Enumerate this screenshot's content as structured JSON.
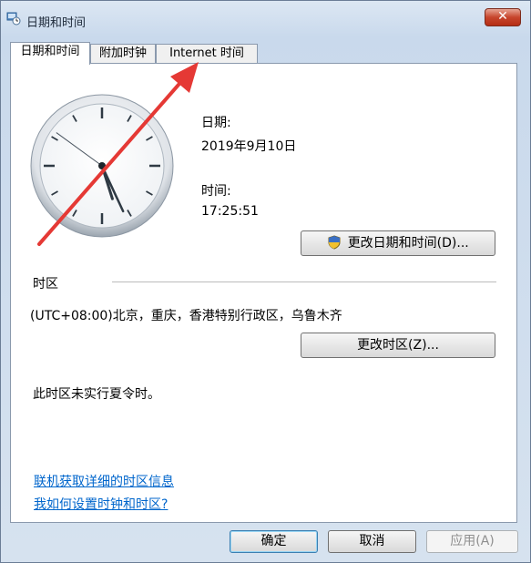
{
  "window": {
    "title": "日期和时间",
    "close_label": "✕"
  },
  "tabs": [
    {
      "label": "日期和时间",
      "active": true
    },
    {
      "label": "附加时钟",
      "active": false
    },
    {
      "label": "Internet 时间",
      "active": false
    }
  ],
  "datetime": {
    "date_label": "日期:",
    "date_value": "2019年9月10日",
    "time_label": "时间:",
    "time_value": "17:25:51",
    "change_button": "更改日期和时间(D)..."
  },
  "timezone": {
    "section_label": "时区",
    "value": "(UTC+08:00)北京，重庆，香港特别行政区，乌鲁木齐",
    "change_button": "更改时区(Z)...",
    "dst_note": "此时区未实行夏令时。"
  },
  "links": {
    "online_info": "联机获取详细的时区信息",
    "how_to": "我如何设置时钟和时区?"
  },
  "footer": {
    "ok": "确定",
    "cancel": "取消",
    "apply": "应用(A)"
  },
  "clock": {
    "hour": 17,
    "minute": 25,
    "second": 51
  },
  "annotation_color": "#e53935"
}
